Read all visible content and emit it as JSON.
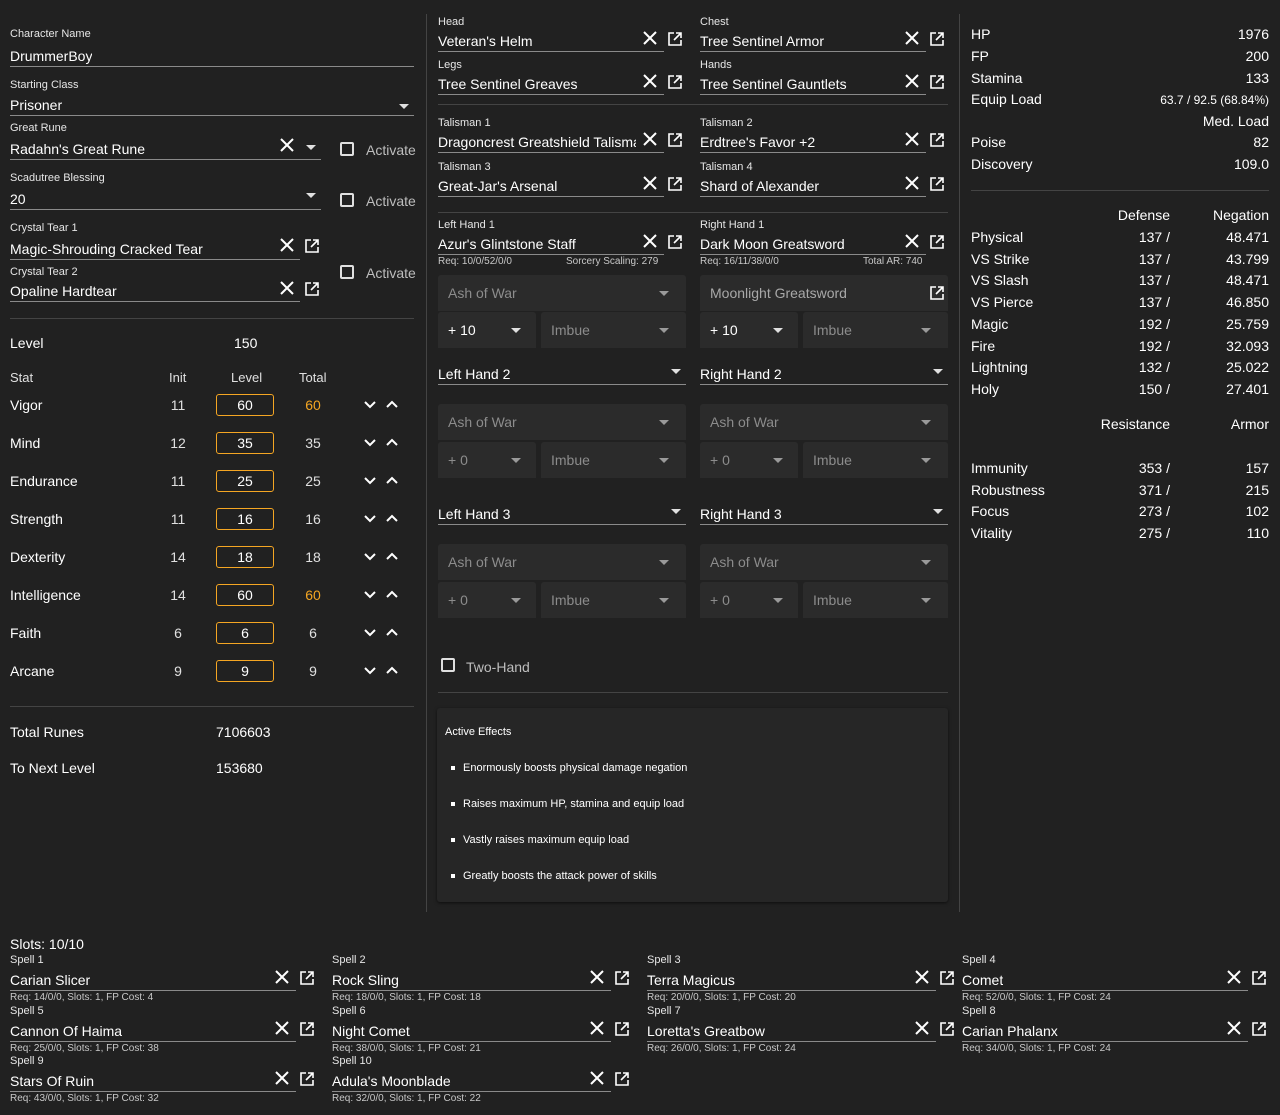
{
  "character": {
    "name_label": "Character Name",
    "name": "DrummerBoy",
    "class_label": "Starting Class",
    "class": "Prisoner",
    "great_rune_label": "Great Rune",
    "great_rune": "Radahn's Great Rune",
    "activate_label": "Activate",
    "blessing_label": "Scadutree Blessing",
    "blessing": "20",
    "tear1_label": "Crystal Tear 1",
    "tear1": "Magic-Shrouding Cracked Tear",
    "tear2_label": "Crystal Tear 2",
    "tear2": "Opaline Hardtear"
  },
  "level": {
    "label": "Level",
    "value": "150"
  },
  "stats": {
    "headers": {
      "stat": "Stat",
      "init": "Init",
      "level": "Level",
      "total": "Total"
    },
    "rows": [
      {
        "name": "Vigor",
        "init": "11",
        "level": "60",
        "total": "60",
        "highlight": true
      },
      {
        "name": "Mind",
        "init": "12",
        "level": "35",
        "total": "35",
        "highlight": false
      },
      {
        "name": "Endurance",
        "init": "11",
        "level": "25",
        "total": "25",
        "highlight": false
      },
      {
        "name": "Strength",
        "init": "11",
        "level": "16",
        "total": "16",
        "highlight": false
      },
      {
        "name": "Dexterity",
        "init": "14",
        "level": "18",
        "total": "18",
        "highlight": false
      },
      {
        "name": "Intelligence",
        "init": "14",
        "level": "60",
        "total": "60",
        "highlight": true
      },
      {
        "name": "Faith",
        "init": "6",
        "level": "6",
        "total": "6",
        "highlight": false
      },
      {
        "name": "Arcane",
        "init": "9",
        "level": "9",
        "total": "9",
        "highlight": false
      }
    ]
  },
  "runes": {
    "total_label": "Total Runes",
    "total": "7106603",
    "next_label": "To Next Level",
    "next": "153680"
  },
  "armor": {
    "head_label": "Head",
    "head": "Veteran's Helm",
    "chest_label": "Chest",
    "chest": "Tree Sentinel Armor",
    "legs_label": "Legs",
    "legs": "Tree Sentinel Greaves",
    "hands_label": "Hands",
    "hands": "Tree Sentinel Gauntlets"
  },
  "talismans": {
    "t1_label": "Talisman 1",
    "t1": "Dragoncrest Greatshield Talisman",
    "t2_label": "Talisman 2",
    "t2": "Erdtree's Favor +2",
    "t3_label": "Talisman 3",
    "t3": "Great-Jar's Arsenal",
    "t4_label": "Talisman 4",
    "t4": "Shard of Alexander"
  },
  "weapons": {
    "lh1_label": "Left Hand 1",
    "lh1": "Azur's Glintstone Staff",
    "lh1_req": "Req: 10/0/52/0/0",
    "lh1_scaling": "Sorcery Scaling: 279",
    "lh1_ash": "Ash of War",
    "lh1_upgrade": "+ 10",
    "lh1_imbue": "Imbue",
    "rh1_label": "Right Hand 1",
    "rh1": "Dark Moon Greatsword",
    "rh1_req": "Req: 16/11/38/0/0",
    "rh1_ar": "Total AR: 740",
    "rh1_ash": "Moonlight Greatsword",
    "rh1_upgrade": "+ 10",
    "rh1_imbue": "Imbue",
    "lh2_label": "Left Hand 2",
    "rh2_label": "Right Hand 2",
    "lh3_label": "Left Hand 3",
    "rh3_label": "Right Hand 3",
    "ash": "Ash of War",
    "upgrade0": "+ 0",
    "imbue": "Imbue",
    "two_hand": "Two-Hand"
  },
  "effects": {
    "title": "Active Effects",
    "items": [
      "Enormously boosts physical damage negation",
      "Raises maximum HP, stamina and equip load",
      "Vastly raises maximum equip load",
      "Greatly boosts the attack power of skills"
    ]
  },
  "summary": {
    "hp_label": "HP",
    "hp": "1976",
    "fp_label": "FP",
    "fp": "200",
    "stamina_label": "Stamina",
    "stamina": "133",
    "equip_label": "Equip Load",
    "equip": "63.7 / 92.5 (68.84%)",
    "equip_class": "Med. Load",
    "poise_label": "Poise",
    "poise": "82",
    "discovery_label": "Discovery",
    "discovery": "109.0"
  },
  "defense": {
    "h_defense": "Defense",
    "h_negation": "Negation",
    "rows": [
      {
        "name": "Physical",
        "def": "137 /",
        "neg": "48.471"
      },
      {
        "name": "VS Strike",
        "def": "137 /",
        "neg": "43.799"
      },
      {
        "name": "VS Slash",
        "def": "137 /",
        "neg": "48.471"
      },
      {
        "name": "VS Pierce",
        "def": "137 /",
        "neg": "46.850"
      },
      {
        "name": "Magic",
        "def": "192 /",
        "neg": "25.759"
      },
      {
        "name": "Fire",
        "def": "192 /",
        "neg": "32.093"
      },
      {
        "name": "Lightning",
        "def": "132 /",
        "neg": "25.022"
      },
      {
        "name": "Holy",
        "def": "150 /",
        "neg": "27.401"
      }
    ]
  },
  "resistance": {
    "h_resistance": "Resistance",
    "h_armor": "Armor",
    "rows": [
      {
        "name": "Immunity",
        "res": "353 /",
        "armor": "157"
      },
      {
        "name": "Robustness",
        "res": "371 /",
        "armor": "215"
      },
      {
        "name": "Focus",
        "res": "273 /",
        "armor": "102"
      },
      {
        "name": "Vitality",
        "res": "275 /",
        "armor": "110"
      }
    ]
  },
  "spells": {
    "slots": "Slots: 10/10",
    "items": [
      {
        "label": "Spell 1",
        "name": "Carian Slicer",
        "req": "Req: 14/0/0, Slots: 1, FP Cost: 4"
      },
      {
        "label": "Spell 2",
        "name": "Rock Sling",
        "req": "Req: 18/0/0, Slots: 1, FP Cost: 18"
      },
      {
        "label": "Spell 3",
        "name": "Terra Magicus",
        "req": "Req: 20/0/0, Slots: 1, FP Cost: 20"
      },
      {
        "label": "Spell 4",
        "name": "Comet",
        "req": "Req: 52/0/0, Slots: 1, FP Cost: 24"
      },
      {
        "label": "Spell 5",
        "name": "Cannon Of Haima",
        "req": "Req: 25/0/0, Slots: 1, FP Cost: 38"
      },
      {
        "label": "Spell 6",
        "name": "Night Comet",
        "req": "Req: 38/0/0, Slots: 1, FP Cost: 21"
      },
      {
        "label": "Spell 7",
        "name": "Loretta's Greatbow",
        "req": "Req: 26/0/0, Slots: 1, FP Cost: 24"
      },
      {
        "label": "Spell 8",
        "name": "Carian Phalanx",
        "req": "Req: 34/0/0, Slots: 1, FP Cost: 24"
      },
      {
        "label": "Spell 9",
        "name": "Stars Of Ruin",
        "req": "Req: 43/0/0, Slots: 1, FP Cost: 32"
      },
      {
        "label": "Spell 10",
        "name": "Adula's Moonblade",
        "req": "Req: 32/0/0, Slots: 1, FP Cost: 22"
      }
    ]
  },
  "colors": {
    "accent": "#f5a623",
    "background": "#212121",
    "panel": "#2b2b2b"
  }
}
